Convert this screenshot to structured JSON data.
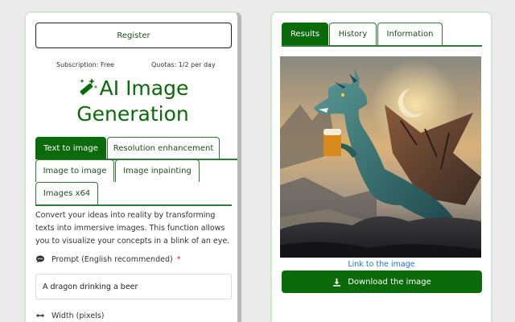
{
  "left": {
    "register_label": "Register",
    "subscription_text": "Subscription: Free",
    "quota_text": "Quotas: 1/2 per day",
    "title_line1": "AI Image",
    "title_line2": "Generation",
    "tabs": [
      {
        "label": "Text to image",
        "active": true
      },
      {
        "label": "Resolution enhancement",
        "active": false
      },
      {
        "label": "Image to image",
        "active": false
      },
      {
        "label": "Image inpainting",
        "active": false
      },
      {
        "label": "Images x64",
        "active": false
      }
    ],
    "description": "Convert your ideas into reality by transforming texts into immersive images. This function allows you to visualize your concepts in a blink of an eye.",
    "prompt_label": "Prompt (English recommended)",
    "prompt_required_marker": "*",
    "prompt_value": "A dragon drinking a beer",
    "width_label": "Width (pixels)",
    "icons": {
      "title": "magic-wand-icon",
      "prompt": "speech-bubble-icon",
      "width": "horizontal-arrows-icon"
    }
  },
  "right": {
    "tabs": [
      {
        "label": "Results",
        "active": true
      },
      {
        "label": "History",
        "active": false
      },
      {
        "label": "Information",
        "active": false
      }
    ],
    "image_link_text": "Link to the image",
    "download_label": "Download the image",
    "icons": {
      "download": "download-icon"
    }
  },
  "colors": {
    "accent": "#0b6b0b",
    "tab_border": "#2e7d32",
    "link": "#1a73e8",
    "required": "#c62828",
    "panel_border": "#cfe8cf",
    "background": "#ebebeb"
  }
}
